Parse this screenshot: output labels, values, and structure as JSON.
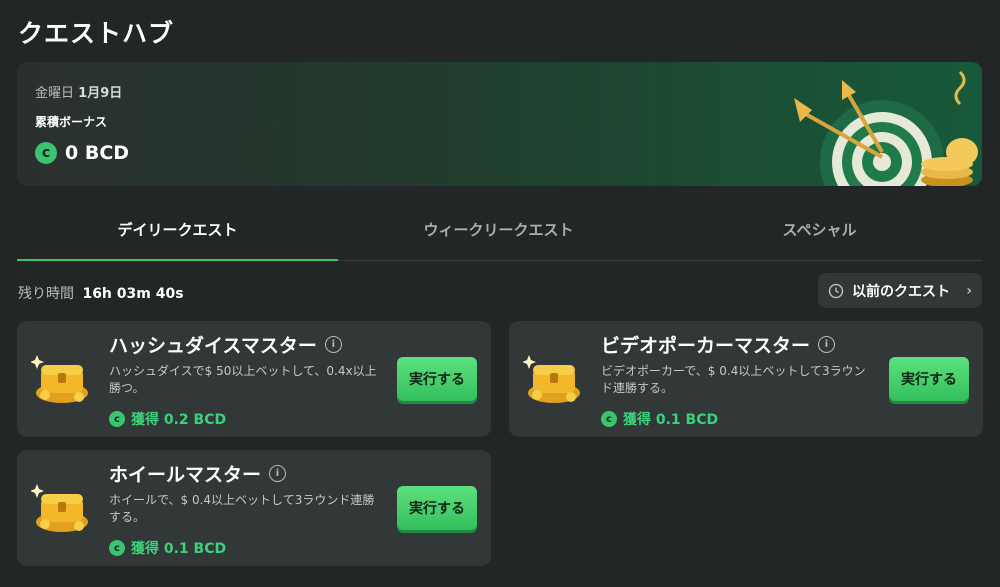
{
  "page": {
    "title": "クエストハブ"
  },
  "banner": {
    "date_prefix": "金曜日",
    "date_value": "1月9日",
    "label": "累積ボーナス",
    "amount": "0 BCD",
    "coin_symbol": "c"
  },
  "tabs": [
    {
      "label": "デイリークエスト",
      "active": true
    },
    {
      "label": "ウィークリークエスト",
      "active": false
    },
    {
      "label": "スペシャル",
      "active": false
    }
  ],
  "timer": {
    "label": "残り時間",
    "value": "16h 03m 40s"
  },
  "previous_quests": {
    "label": "以前のクエスト"
  },
  "quests": [
    {
      "title": "ハッシュダイスマスター",
      "description": "ハッシュダイスで$ 50以上ベットして、0.4x以上勝つ。",
      "reward": "獲得 0.2 BCD",
      "button": "実行する"
    },
    {
      "title": "ビデオポーカーマスター",
      "description": "ビデオポーカーで、$ 0.4以上ベットして3ラウンド連勝する。",
      "reward": "獲得 0.1 BCD",
      "button": "実行する"
    },
    {
      "title": "ホイールマスター",
      "description": "ホイールで、$ 0.4以上ベットして3ラウンド連勝する。",
      "reward": "獲得 0.1 BCD",
      "button": "実行する"
    }
  ],
  "colors": {
    "accent": "#3bc46f",
    "background": "#232626",
    "card": "#323737"
  }
}
